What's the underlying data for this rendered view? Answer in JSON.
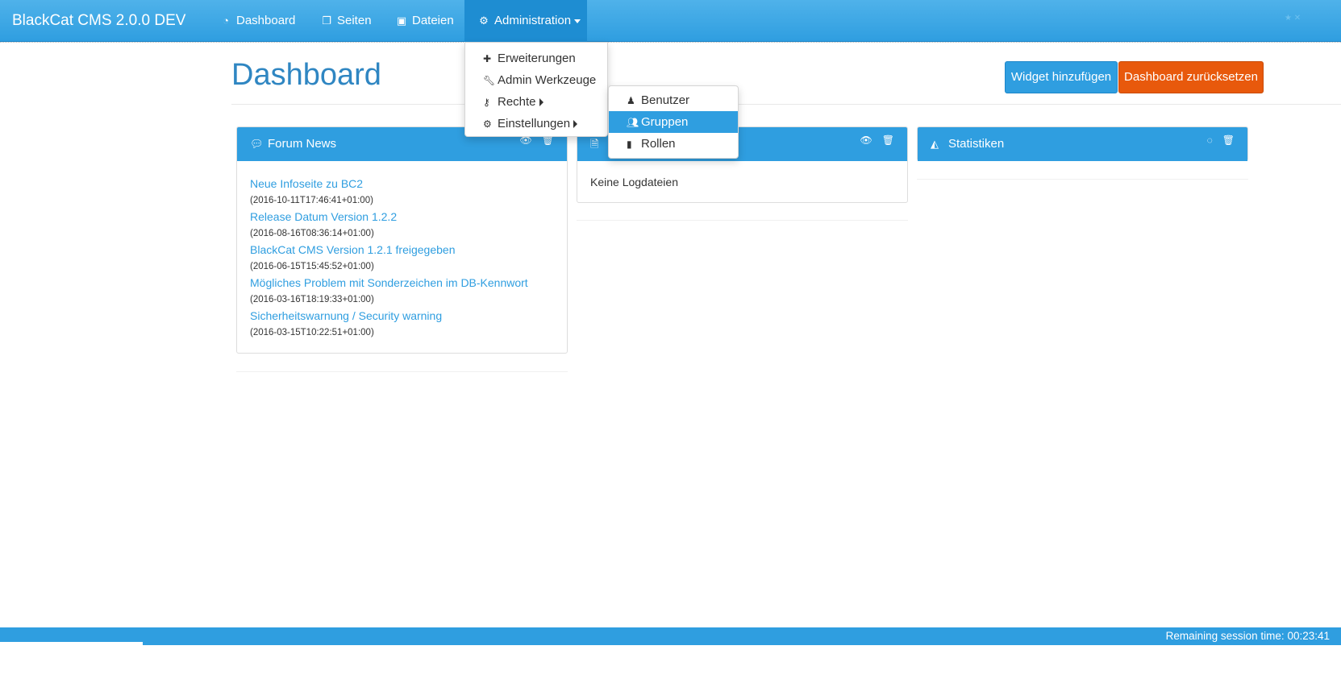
{
  "navbar": {
    "brand": "BlackCat CMS 2.0.0 DEV",
    "items": [
      {
        "label": "Dashboard",
        "icon": "dashboard-icon"
      },
      {
        "label": "Seiten",
        "icon": "pages-icon"
      },
      {
        "label": "Dateien",
        "icon": "files-icon"
      },
      {
        "label": "Administration",
        "icon": "gears-icon"
      }
    ]
  },
  "admin_menu": {
    "items": [
      {
        "label": "Erweiterungen",
        "icon": "puzzle-icon"
      },
      {
        "label": "Admin Werkzeuge",
        "icon": "wrench-icon"
      },
      {
        "label": "Rechte",
        "icon": "key-icon"
      },
      {
        "label": "Einstellungen",
        "icon": "gears-icon"
      }
    ]
  },
  "rights_submenu": {
    "items": [
      {
        "label": "Benutzer",
        "icon": "user-icon"
      },
      {
        "label": "Gruppen",
        "icon": "users-icon"
      },
      {
        "label": "Rollen",
        "icon": "bookmark-icon"
      }
    ],
    "highlighted": "Gruppen"
  },
  "page": {
    "title": "Dashboard",
    "add_widget_label": "Widget hinzufügen",
    "reset_dashboard_label": "Dashboard zurücksetzen"
  },
  "widgets": {
    "forum_news": {
      "title": "Forum News",
      "items": [
        {
          "title": "Neue Infoseite zu BC2",
          "date": "(2016-10-11T17:46:41+01:00)"
        },
        {
          "title": "Release Datum Version 1.2.2",
          "date": "(2016-08-16T08:36:14+01:00)"
        },
        {
          "title": "BlackCat CMS Version 1.2.1 freigegeben",
          "date": "(2016-06-15T15:45:52+01:00)"
        },
        {
          "title": "Mögliches Problem mit Sonderzeichen im DB-Kennwort",
          "date": "(2016-03-16T18:19:33+01:00)"
        },
        {
          "title": "Sicherheitswarnung / Security warning",
          "date": "(2016-03-15T10:22:51+01:00)"
        }
      ]
    },
    "logs": {
      "message": "Keine Logdateien"
    },
    "statistics": {
      "title": "Statistiken"
    }
  },
  "footer": {
    "session_text": "Remaining session time: 00:23:41"
  },
  "colors": {
    "primary": "#2f9ee0",
    "danger": "#e8590c",
    "title": "#2f86c2"
  }
}
